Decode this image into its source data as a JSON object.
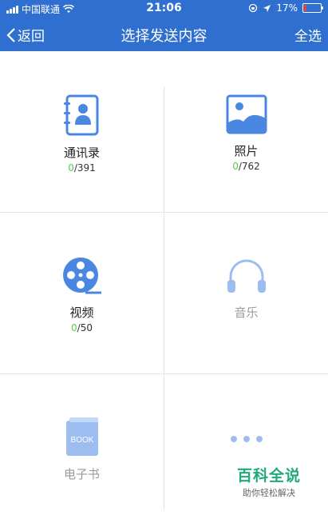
{
  "status_bar": {
    "carrier": "中国联通",
    "time": "21:06",
    "battery": "17%",
    "battery_level": 0.17
  },
  "nav": {
    "back_label": "返回",
    "title": "选择发送内容",
    "select_all_label": "全选"
  },
  "items": [
    {
      "label": "通讯录",
      "selected": "0",
      "total": "/391",
      "icon": "contacts-icon"
    },
    {
      "label": "照片",
      "selected": "0",
      "total": "/762",
      "icon": "photo-icon"
    },
    {
      "label": "视频",
      "selected": "0",
      "total": "/50",
      "icon": "video-reel-icon"
    },
    {
      "label": "音乐",
      "icon": "headphones-icon"
    },
    {
      "label": "电子书",
      "book_text": "BOOK",
      "icon": "book-icon"
    },
    {
      "label": "",
      "icon": "more-dots-icon"
    }
  ],
  "watermark": {
    "title": "百科全说",
    "subtitle": "助你轻松解决"
  },
  "colors": {
    "primary": "#2f6fcf",
    "icon_blue": "#4a87e0",
    "icon_light": "#9dbdf0",
    "selected_green": "#5ac85a"
  }
}
